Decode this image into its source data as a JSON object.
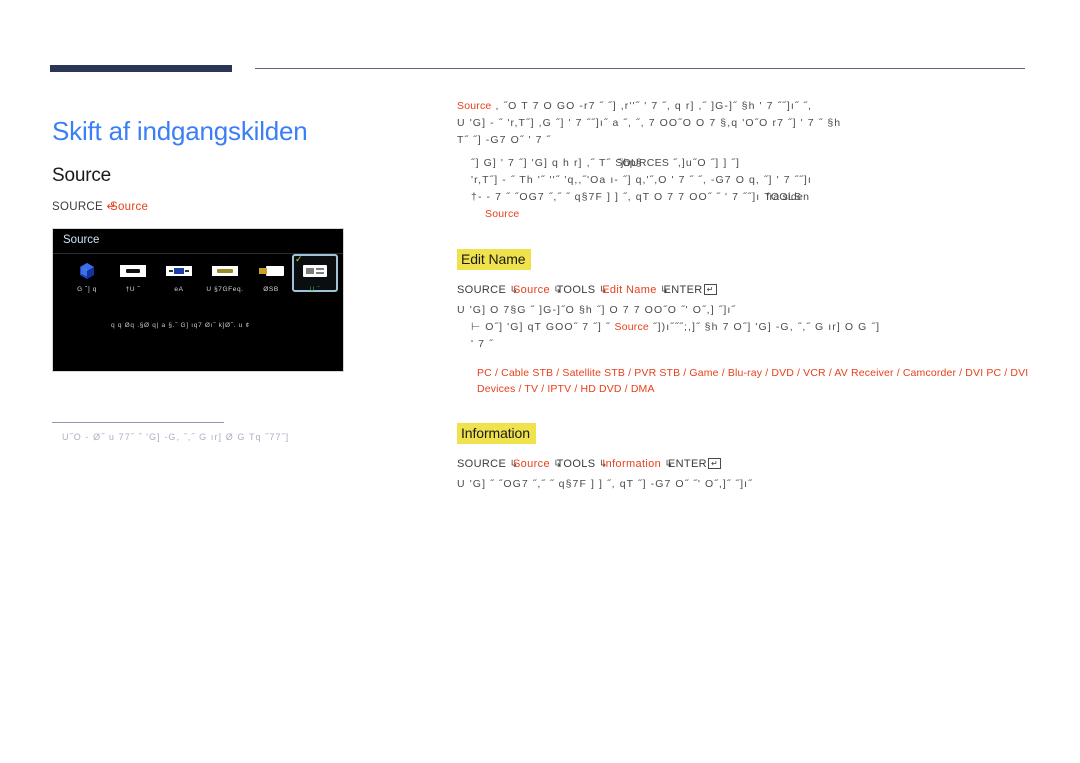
{
  "page": {
    "title": "Skift af indgangskilden",
    "title_color": "#3b7ff6",
    "rule_color": "#2b3557"
  },
  "left": {
    "section_heading": "Source",
    "nav_path_prefix": "SOURCE",
    "nav_path_arrow": "↵",
    "nav_path_target": "Source",
    "tv": {
      "menu_title": "Source",
      "items": [
        {
          "label": "G   ˘] q",
          "icon": "network-icon",
          "selected": false
        },
        {
          "label": "†U ˘",
          "icon": "hdmi-icon",
          "selected": false
        },
        {
          "label": "eA",
          "icon": "dvi-icon",
          "selected": false
        },
        {
          "label": "U  §7GFeq.",
          "icon": "display-port-icon",
          "selected": false
        },
        {
          "label": "ØSB",
          "icon": "usb-icon",
          "selected": false
        },
        {
          "label": "U ˘",
          "icon": "pc-icon",
          "selected": true
        }
      ],
      "more_arrow": "›",
      "check_glyph": "✓",
      "subtext": "q  q Øq .§Ø q| a §.˝   G]  ıq7  Øı˝ k]Ø˝. u ¢"
    },
    "footnote": "U˝O -  Ø˝ u 77˝ ˝ 'G] -G, ˝,˝ G ır]   Ø G  Tq ˝77˝]"
  },
  "right": {
    "intro": {
      "accent_lead": "Source",
      "line1": ",  ˝O T 7  O GO -r7 ˝ ˝] ,r''˝ ' 7 ˝, q  r] ,˝ ]G-]˝ §h ' 7 ˝˝]ı˝ ˝,",
      "line2": "U  'G] -  ˝  'r,T˝]  ,G ˝] ' 7 ˝˝]ı˝ a  ˝, ˝,  7 OO˝O O 7 §,q  'O˝O   r7  ˝] ' 7 ˝ §h",
      "line3": "T˝   ˝] -G7 O˝ ' 7 ˝"
    },
    "bullets": [
      {
        "text": "˝]  G]  ' 7 ˝] 'G] q   h  r] ,˝   T˝",
        "overlay_under": "SOURCES",
        "overlay_over": "˝jhp§",
        "tail": "˝,]u˝O ˝] ] ˝]"
      },
      {
        "text": "'r,T˝] -  ˝   Th '˝  ''˝ 'q,,˝'Oa ı-   ˝]  q,'˝,O ' 7 ˝ ˝, -G7 O   q,  ˝] ' 7 ˝˝]ı"
      },
      {
        "text": "†-       - 7  ˝  ˝OG7 ˝,˝ ˝ q§7F ] ] ˝, qT O 7 7 OO˝ ˝ ' 7 ˝˝]ı",
        "overlay_under": "TOOLS",
        "overlay_over": "fra siden",
        "tail_accent": "Source"
      }
    ],
    "edit_name": {
      "heading": "Edit Name",
      "nav": {
        "p1": "SOURCE",
        "p2": "Source",
        "p3": "TOOLS",
        "p4": "Edit Name",
        "p5": "ENTER",
        "kbd": "↵"
      },
      "body_line1": "U  'G] O 7§G  ˝ ]G-]˝O §h ˝] O 7 7 OO˝O ˝' O˝,] ˝]ı˝",
      "body_line2_pre": "⊢  O˝] 'G] qT GOO˝   7 ˝] ˝",
      "body_line2_accent": "Source",
      "body_line2_post": "˝])ı˝˝˝;,]˝ §h 7  O˝] 'G] -G, ˝,˝ G ır]    O G  ˝]",
      "body_line3": "' 7 ˝",
      "devices": "PC / Cable STB / Satellite STB / PVR STB / Game / Blu-ray  / DVD / VCR / AV Receiver / Camcorder / DVI PC / DVI Devices / TV / IPTV / HD DVD / DMA"
    },
    "information": {
      "heading": "Information",
      "nav": {
        "p1": "SOURCE",
        "p2": "Source",
        "p3": "TOOLS",
        "p4": "Information",
        "p5": "ENTER",
        "kbd": "↵"
      },
      "body_line1": "U  'G]  ˝  ˝OG7 ˝,˝ ˝ q§7F ] ] ˝, qT  ˝] -G7 O˝ ˝' O˝,]˝ ˝]ı˝"
    }
  }
}
